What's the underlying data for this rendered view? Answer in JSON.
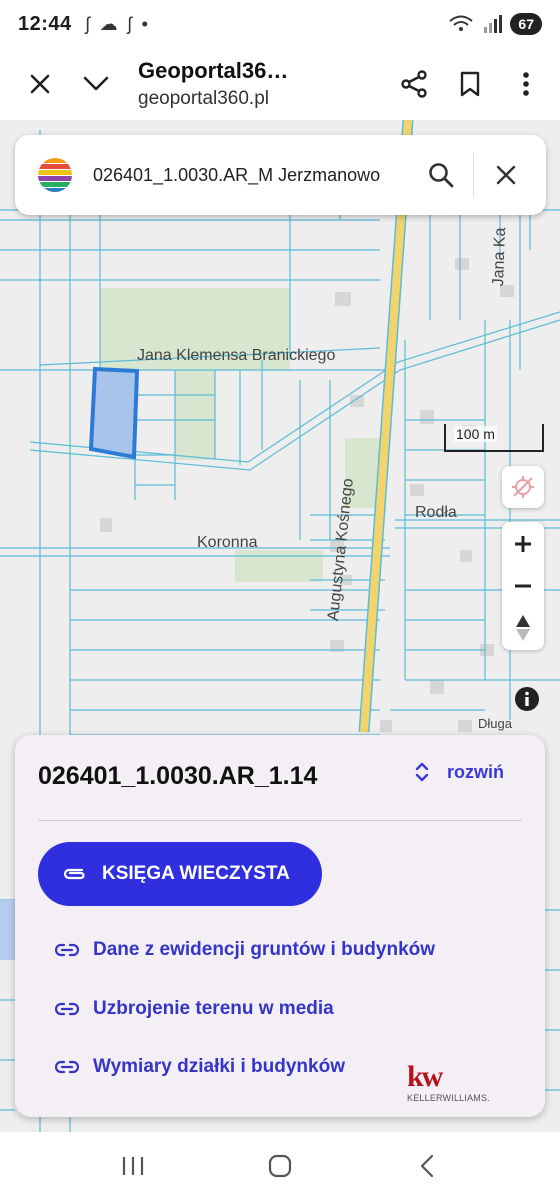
{
  "status": {
    "time": "12:44",
    "battery": "67"
  },
  "browser": {
    "title": "Geoportal36…",
    "url": "geoportal360.pl"
  },
  "search": {
    "query": "026401_1.0030.AR_M Jerzmanowo"
  },
  "map": {
    "labels": {
      "street_branickiego": "Jana Klemensa Branickiego",
      "street_koronna": "Koronna",
      "street_kosnego": "Augustyna Kośnego",
      "street_rodla": "Rodła",
      "street_jana_ka": "Jana Ka",
      "street_dluga": "Długa"
    },
    "scale_label": "100 m",
    "colors": {
      "background": "#eeeeee",
      "parcel_lines": "#5bbcd6",
      "main_road": "#f3d36b",
      "green_area": "#d8e6cf",
      "selected_parcel_fill": "#a9c4ea",
      "selected_parcel_stroke": "#2d7ad6"
    }
  },
  "panel": {
    "parcel_id": "026401_1.0030.AR_1.14",
    "expand_label": "rozwiń",
    "primary_button": "KSIĘGA WIECZYSTA",
    "links": [
      "Dane z ewidencji gruntów i budynków",
      "Uzbrojenie terenu w media",
      "Wymiary działki i budynków"
    ],
    "logo": {
      "mark": "kw",
      "text": "KELLERWILLIAMS."
    },
    "accent_color": "#2f2fe0"
  }
}
